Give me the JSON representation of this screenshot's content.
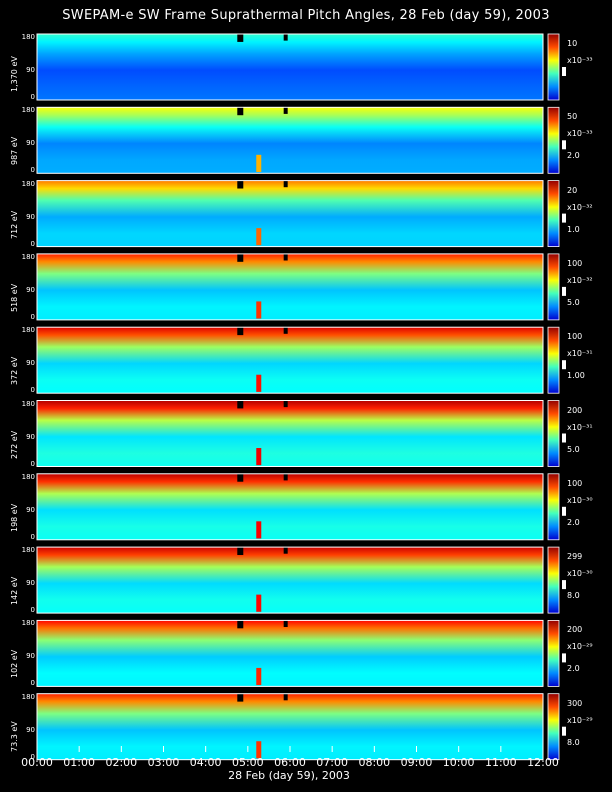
{
  "title": "SWEPAM-e SW Frame Suprathermal Pitch Angles, 28 Feb (day  59), 2003",
  "x_axis_title": "28 Feb (day  59), 2003",
  "colors": {
    "background": "#000000",
    "frame": "#ffffff"
  },
  "chart_data": {
    "type": "heatmap",
    "title": "SWEPAM-e SW Frame Suprathermal Pitch Angles, 28 Feb (day  59), 2003",
    "xlabel": "28 Feb (day  59), 2003",
    "x_ticks": [
      "00:00",
      "01:00",
      "02:00",
      "03:00",
      "04:00",
      "05:00",
      "06:00",
      "07:00",
      "08:00",
      "09:00",
      "10:00",
      "11:00",
      "12:00"
    ],
    "xlim_hours": [
      0,
      12
    ],
    "ylim_degrees": [
      0,
      180
    ],
    "y_ticks": [
      "0",
      "90",
      "180"
    ],
    "panels": [
      {
        "energy": "1,370 eV",
        "cb_top": "10",
        "cb_exp": "x10⁻³³",
        "cb_mid": ""
      },
      {
        "energy": "987 eV",
        "cb_top": "50",
        "cb_exp": "x10⁻³³",
        "cb_mid": "2.0"
      },
      {
        "energy": "712 eV",
        "cb_top": "20",
        "cb_exp": "x10⁻³²",
        "cb_mid": "1.0"
      },
      {
        "energy": "518 eV",
        "cb_top": "100",
        "cb_exp": "x10⁻³²",
        "cb_mid": "5.0"
      },
      {
        "energy": "372 eV",
        "cb_top": "100",
        "cb_exp": "x10⁻³¹",
        "cb_mid": "1.00"
      },
      {
        "energy": "272 eV",
        "cb_top": "200",
        "cb_exp": "x10⁻³¹",
        "cb_mid": "5.0"
      },
      {
        "energy": "198 eV",
        "cb_top": "100",
        "cb_exp": "x10⁻³⁰",
        "cb_mid": "2.0"
      },
      {
        "energy": "142 eV",
        "cb_top": "299",
        "cb_exp": "x10⁻³⁰",
        "cb_mid": "8.0"
      },
      {
        "energy": "102 eV",
        "cb_top": "200",
        "cb_exp": "x10⁻²⁹",
        "cb_mid": "2.0"
      },
      {
        "energy": "73.3 eV",
        "cb_top": "300",
        "cb_exp": "x10⁻²⁹",
        "cb_mid": "8.0"
      }
    ]
  }
}
